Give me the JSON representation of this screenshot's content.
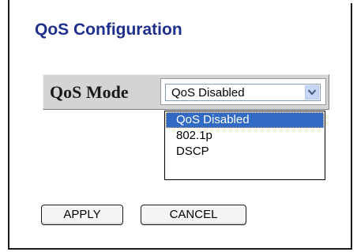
{
  "page": {
    "title": "QoS Configuration"
  },
  "qos_mode": {
    "label": "QoS Mode",
    "selected_value": "QoS Disabled",
    "options": [
      {
        "label": "QoS Disabled",
        "selected": true
      },
      {
        "label": "802.1p",
        "selected": false
      },
      {
        "label": "DSCP",
        "selected": false
      }
    ]
  },
  "buttons": {
    "apply_label": "APPLY",
    "cancel_label": "CANCEL"
  },
  "icons": {
    "dropdown_arrow": "chevron-down-icon"
  },
  "colors": {
    "title": "#1f2f8c",
    "selected_option_bg": "#316ac5",
    "row_bg": "#d4d4d4"
  }
}
